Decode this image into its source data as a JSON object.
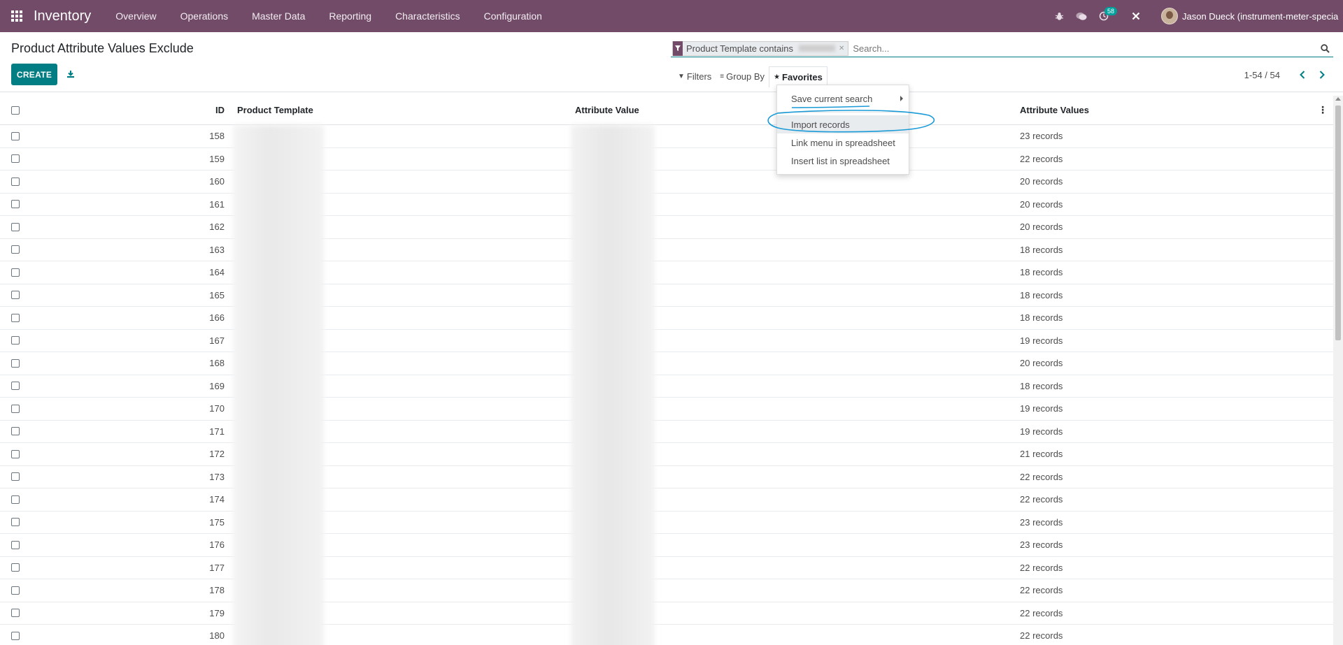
{
  "navbar": {
    "brand": "Inventory",
    "menu": [
      "Overview",
      "Operations",
      "Master Data",
      "Reporting",
      "Characteristics",
      "Configuration"
    ],
    "activity_count": "58",
    "user_name": "Jason Dueck (instrument-meter-speciali..."
  },
  "control_panel": {
    "title": "Product Attribute Values Exclude",
    "create_label": "CREATE",
    "facet_label": "Product Template contains",
    "search_placeholder": "Search...",
    "filters_label": "Filters",
    "group_by_label": "Group By",
    "favorites_label": "Favorites",
    "pager_value": "1-54 / 54"
  },
  "favorites_menu": {
    "items": [
      "Save current search",
      "Import records",
      "Link menu in spreadsheet",
      "Insert list in spreadsheet"
    ]
  },
  "annotation_color": "#1a9bd7",
  "table": {
    "headers": {
      "id": "ID",
      "product_template": "Product Template",
      "attribute_value": "Attribute Value",
      "attribute_values": "Attribute Values"
    },
    "rows": [
      {
        "id": "158",
        "values": "23 records"
      },
      {
        "id": "159",
        "values": "22 records"
      },
      {
        "id": "160",
        "values": "20 records"
      },
      {
        "id": "161",
        "values": "20 records"
      },
      {
        "id": "162",
        "values": "20 records"
      },
      {
        "id": "163",
        "values": "18 records"
      },
      {
        "id": "164",
        "values": "18 records"
      },
      {
        "id": "165",
        "values": "18 records"
      },
      {
        "id": "166",
        "values": "18 records"
      },
      {
        "id": "167",
        "values": "19 records"
      },
      {
        "id": "168",
        "values": "20 records"
      },
      {
        "id": "169",
        "values": "18 records"
      },
      {
        "id": "170",
        "values": "19 records"
      },
      {
        "id": "171",
        "values": "19 records"
      },
      {
        "id": "172",
        "values": "21 records"
      },
      {
        "id": "173",
        "values": "22 records"
      },
      {
        "id": "174",
        "values": "22 records"
      },
      {
        "id": "175",
        "values": "23 records"
      },
      {
        "id": "176",
        "values": "23 records"
      },
      {
        "id": "177",
        "values": "22 records"
      },
      {
        "id": "178",
        "values": "22 records"
      },
      {
        "id": "179",
        "values": "22 records"
      },
      {
        "id": "180",
        "values": "22 records"
      }
    ]
  }
}
